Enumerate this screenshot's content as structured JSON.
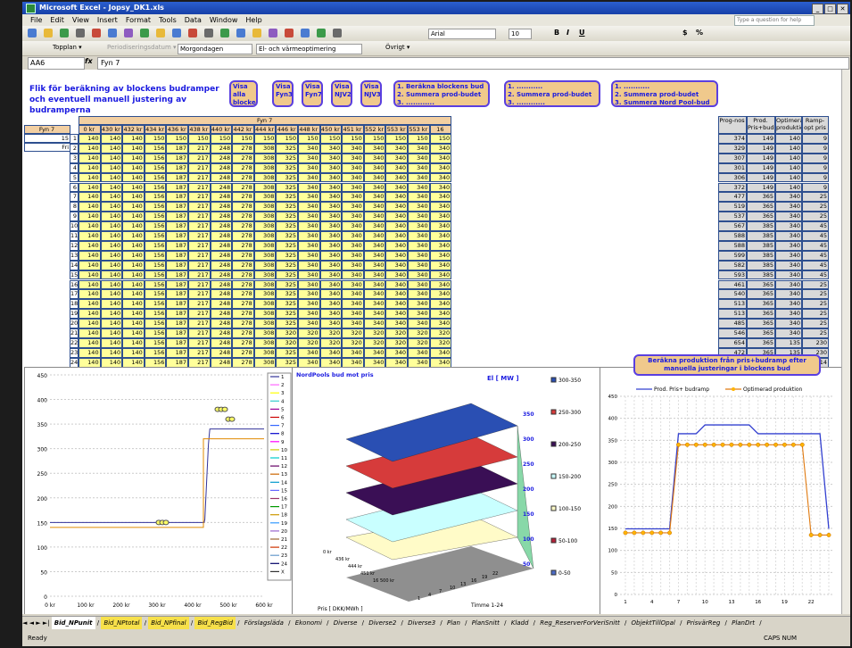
{
  "window": {
    "title": "Microsoft Excel - Jopsy_DK1.xls",
    "buttons": [
      "_",
      "□",
      "✕"
    ]
  },
  "menu": {
    "items": [
      "File",
      "Edit",
      "View",
      "Insert",
      "Format",
      "Tools",
      "Data",
      "Window",
      "Help"
    ],
    "help_placeholder": "Type a question for help"
  },
  "toolbar": {
    "font": "Arial",
    "size": "10",
    "bold": "B",
    "italic": "I",
    "underline": "U",
    "currency": "$",
    "percent": "%"
  },
  "toolbar2": {
    "topplan": "Topplan ▾",
    "period": "Periodiseringsdatum ▾",
    "dropdown1": "Morgondagen",
    "dropdown2": "El- och värmeoptimering",
    "ovrigt": "Övrigt ▾"
  },
  "namebox": "AA6",
  "fx": "fx",
  "formula": "Fyn 7",
  "sheet": {
    "title": "Flik för beräkning av blockens budramper och eventuell manuell justering av budramperna",
    "buttons": [
      "Visa alla blocken",
      "Visa Fyn3",
      "Visa Fyn7",
      "Visa NJV2",
      "Visa NJV3"
    ],
    "step_box1": [
      "1. Beräkna blockens bud",
      "2. Summera prod-budet",
      "3. ............"
    ],
    "step_box2": [
      "1. ...........",
      "2. Summera prod-budet",
      "3. ............"
    ],
    "step_box3": [
      "1. ...........",
      "2. Summera prod-budet",
      "3. Summera Nord Pool-bud"
    ],
    "fyn_header": "Fyn 7",
    "selector": [
      "Fyn 7",
      "15",
      "Fri"
    ],
    "col_headers": [
      "0 kr",
      "430 kr",
      "432 kr",
      "434 kr",
      "436 kr",
      "438 kr",
      "440 kr",
      "442 kr",
      "444 kr",
      "446 kr",
      "448 kr",
      "450 kr",
      "451 kr",
      "552 kr",
      "553 kr",
      "553 kr",
      "16 500 kr"
    ],
    "right_headers": [
      "Prog-nos",
      "Prod. Pris+budramp",
      "Optimerad produktion",
      "Ramp-opt pris"
    ],
    "rows": [
      {
        "n": "1",
        "v": [
          "140",
          "140",
          "140",
          "150",
          "150",
          "150",
          "150",
          "150",
          "150",
          "150",
          "150",
          "150",
          "150",
          "150",
          "150",
          "150",
          "150"
        ],
        "r": [
          "374",
          "149",
          "140",
          "9"
        ]
      },
      {
        "n": "2",
        "v": [
          "140",
          "140",
          "140",
          "156",
          "187",
          "217",
          "248",
          "278",
          "308",
          "325",
          "340",
          "340",
          "340",
          "340",
          "340",
          "340",
          "340"
        ],
        "r": [
          "329",
          "149",
          "140",
          "9"
        ]
      },
      {
        "n": "3",
        "v": [
          "140",
          "140",
          "140",
          "156",
          "187",
          "217",
          "248",
          "278",
          "308",
          "325",
          "340",
          "340",
          "340",
          "340",
          "340",
          "340",
          "340"
        ],
        "r": [
          "307",
          "149",
          "140",
          "9"
        ]
      },
      {
        "n": "4",
        "v": [
          "140",
          "140",
          "140",
          "156",
          "187",
          "217",
          "248",
          "278",
          "308",
          "325",
          "340",
          "340",
          "340",
          "340",
          "340",
          "340",
          "340"
        ],
        "r": [
          "301",
          "149",
          "140",
          "9"
        ]
      },
      {
        "n": "5",
        "v": [
          "140",
          "140",
          "140",
          "156",
          "187",
          "217",
          "248",
          "278",
          "308",
          "325",
          "340",
          "340",
          "340",
          "340",
          "340",
          "340",
          "340"
        ],
        "r": [
          "306",
          "149",
          "140",
          "9"
        ]
      },
      {
        "n": "6",
        "v": [
          "140",
          "140",
          "140",
          "156",
          "187",
          "217",
          "248",
          "278",
          "308",
          "325",
          "340",
          "340",
          "340",
          "340",
          "340",
          "340",
          "340"
        ],
        "r": [
          "372",
          "149",
          "140",
          "9"
        ]
      },
      {
        "n": "7",
        "v": [
          "140",
          "140",
          "140",
          "156",
          "187",
          "217",
          "248",
          "278",
          "308",
          "325",
          "340",
          "340",
          "340",
          "340",
          "340",
          "340",
          "340"
        ],
        "r": [
          "477",
          "365",
          "340",
          "25"
        ]
      },
      {
        "n": "8",
        "v": [
          "140",
          "140",
          "140",
          "156",
          "187",
          "217",
          "248",
          "278",
          "308",
          "325",
          "340",
          "340",
          "340",
          "340",
          "340",
          "340",
          "340"
        ],
        "r": [
          "519",
          "365",
          "340",
          "25"
        ]
      },
      {
        "n": "9",
        "v": [
          "140",
          "140",
          "140",
          "156",
          "187",
          "217",
          "248",
          "278",
          "308",
          "325",
          "340",
          "340",
          "340",
          "340",
          "340",
          "340",
          "340"
        ],
        "r": [
          "537",
          "365",
          "340",
          "25"
        ]
      },
      {
        "n": "10",
        "v": [
          "140",
          "140",
          "140",
          "156",
          "187",
          "217",
          "248",
          "278",
          "308",
          "325",
          "340",
          "340",
          "340",
          "340",
          "340",
          "340",
          "340"
        ],
        "r": [
          "567",
          "385",
          "340",
          "45"
        ]
      },
      {
        "n": "11",
        "v": [
          "140",
          "140",
          "140",
          "156",
          "187",
          "217",
          "248",
          "278",
          "308",
          "325",
          "340",
          "340",
          "340",
          "340",
          "340",
          "340",
          "340"
        ],
        "r": [
          "588",
          "385",
          "340",
          "45"
        ]
      },
      {
        "n": "12",
        "v": [
          "140",
          "140",
          "140",
          "156",
          "187",
          "217",
          "248",
          "278",
          "308",
          "325",
          "340",
          "340",
          "340",
          "340",
          "340",
          "340",
          "340"
        ],
        "r": [
          "588",
          "385",
          "340",
          "45"
        ]
      },
      {
        "n": "13",
        "v": [
          "140",
          "140",
          "140",
          "156",
          "187",
          "217",
          "248",
          "278",
          "308",
          "325",
          "340",
          "340",
          "340",
          "340",
          "340",
          "340",
          "340"
        ],
        "r": [
          "599",
          "385",
          "340",
          "45"
        ]
      },
      {
        "n": "14",
        "v": [
          "140",
          "140",
          "140",
          "156",
          "187",
          "217",
          "248",
          "278",
          "308",
          "325",
          "340",
          "340",
          "340",
          "340",
          "340",
          "340",
          "340"
        ],
        "r": [
          "582",
          "385",
          "340",
          "45"
        ]
      },
      {
        "n": "15",
        "v": [
          "140",
          "140",
          "140",
          "156",
          "187",
          "217",
          "248",
          "278",
          "308",
          "325",
          "340",
          "340",
          "340",
          "340",
          "340",
          "340",
          "340"
        ],
        "r": [
          "593",
          "385",
          "340",
          "45"
        ]
      },
      {
        "n": "16",
        "v": [
          "140",
          "140",
          "140",
          "156",
          "187",
          "217",
          "248",
          "278",
          "308",
          "325",
          "340",
          "340",
          "340",
          "340",
          "340",
          "340",
          "340"
        ],
        "r": [
          "461",
          "365",
          "340",
          "25"
        ]
      },
      {
        "n": "17",
        "v": [
          "140",
          "140",
          "140",
          "156",
          "187",
          "217",
          "248",
          "278",
          "308",
          "325",
          "340",
          "340",
          "340",
          "340",
          "340",
          "340",
          "340"
        ],
        "r": [
          "540",
          "365",
          "340",
          "25"
        ]
      },
      {
        "n": "18",
        "v": [
          "140",
          "140",
          "140",
          "156",
          "187",
          "217",
          "248",
          "278",
          "308",
          "325",
          "340",
          "340",
          "340",
          "340",
          "340",
          "340",
          "340"
        ],
        "r": [
          "513",
          "365",
          "340",
          "25"
        ]
      },
      {
        "n": "19",
        "v": [
          "140",
          "140",
          "140",
          "156",
          "187",
          "217",
          "248",
          "278",
          "308",
          "325",
          "340",
          "340",
          "340",
          "340",
          "340",
          "340",
          "340"
        ],
        "r": [
          "513",
          "365",
          "340",
          "25"
        ]
      },
      {
        "n": "20",
        "v": [
          "140",
          "140",
          "140",
          "156",
          "187",
          "217",
          "248",
          "278",
          "308",
          "325",
          "340",
          "340",
          "340",
          "340",
          "340",
          "340",
          "340"
        ],
        "r": [
          "485",
          "365",
          "340",
          "25"
        ]
      },
      {
        "n": "21",
        "v": [
          "140",
          "140",
          "140",
          "156",
          "187",
          "217",
          "248",
          "278",
          "308",
          "320",
          "320",
          "320",
          "320",
          "320",
          "320",
          "320",
          "320"
        ],
        "r": [
          "546",
          "365",
          "340",
          "25"
        ]
      },
      {
        "n": "22",
        "v": [
          "140",
          "140",
          "140",
          "156",
          "187",
          "217",
          "248",
          "278",
          "308",
          "320",
          "320",
          "320",
          "320",
          "320",
          "320",
          "320",
          "320"
        ],
        "r": [
          "654",
          "365",
          "135",
          "230"
        ]
      },
      {
        "n": "23",
        "v": [
          "140",
          "140",
          "140",
          "156",
          "187",
          "217",
          "248",
          "278",
          "308",
          "325",
          "340",
          "340",
          "340",
          "340",
          "340",
          "340",
          "340"
        ],
        "r": [
          "472",
          "365",
          "135",
          "230"
        ]
      },
      {
        "n": "24",
        "v": [
          "140",
          "140",
          "140",
          "156",
          "187",
          "217",
          "248",
          "278",
          "308",
          "325",
          "340",
          "340",
          "340",
          "340",
          "340",
          "340",
          "340"
        ],
        "r": [
          "373",
          "149",
          "135",
          "14"
        ]
      }
    ]
  },
  "chart_left": {
    "y_ticks": [
      "0",
      "50",
      "100",
      "150",
      "200",
      "250",
      "300",
      "350",
      "400",
      "450"
    ],
    "x_ticks": [
      "0 kr",
      "100 kr",
      "200 kr",
      "300 kr",
      "400 kr",
      "500 kr",
      "600 kr"
    ],
    "legend": [
      "1",
      "2",
      "3",
      "4",
      "5",
      "6",
      "7",
      "8",
      "9",
      "10",
      "11",
      "12",
      "13",
      "14",
      "15",
      "16",
      "17",
      "18",
      "19",
      "20",
      "21",
      "22",
      "23",
      "24",
      "X"
    ]
  },
  "chart_3d": {
    "title": "NordPools bud mot pris",
    "zlabel": "El [ MW ]",
    "z_ticks": [
      "50",
      "100",
      "150",
      "200",
      "250",
      "300",
      "350"
    ],
    "xlabel": "Pris [ DKK/MWh ]",
    "ylabel": "Timme 1-24",
    "x_ticks": [
      "0 kr",
      "436 kr",
      "444 kr",
      "451 kr",
      "16 500 kr"
    ],
    "y_ticks": [
      "1",
      "4",
      "7",
      "10",
      "13",
      "16",
      "19",
      "22"
    ],
    "legend": [
      {
        "label": "300-350",
        "color": "#2a4fb3"
      },
      {
        "label": "250-300",
        "color": "#d63b3b"
      },
      {
        "label": "200-250",
        "color": "#3a0f55"
      },
      {
        "label": "150-200",
        "color": "#c9ffff"
      },
      {
        "label": "100-150",
        "color": "#fffbc8"
      },
      {
        "label": "50-100",
        "color": "#b4223a"
      },
      {
        "label": "0-50",
        "color": "#4e6cc7"
      }
    ]
  },
  "chart_right": {
    "button": "Beräkna produktion från pris+budramp efter manuella justeringar i blockens bud",
    "legend": [
      "Prod. Pris+ budramp",
      "Optimerad produktion"
    ],
    "y_ticks": [
      "0",
      "50",
      "100",
      "150",
      "200",
      "250",
      "300",
      "350",
      "400",
      "450"
    ],
    "x_ticks": [
      "1",
      "4",
      "7",
      "10",
      "13",
      "16",
      "19",
      "22"
    ]
  },
  "chart_data": [
    {
      "type": "line",
      "title": "",
      "x": [
        "1",
        "2",
        "3",
        "4",
        "5",
        "6",
        "7",
        "8",
        "9",
        "10",
        "11",
        "12",
        "13",
        "14",
        "15",
        "16",
        "17",
        "18",
        "19",
        "20",
        "21",
        "22",
        "23",
        "24"
      ],
      "ylim": [
        0,
        450
      ],
      "series": [
        {
          "name": "Prod. Pris+ budramp",
          "values": [
            149,
            149,
            149,
            149,
            149,
            149,
            365,
            365,
            365,
            385,
            385,
            385,
            385,
            385,
            385,
            365,
            365,
            365,
            365,
            365,
            365,
            365,
            365,
            149
          ]
        },
        {
          "name": "Optimerad produktion",
          "values": [
            140,
            140,
            140,
            140,
            140,
            140,
            340,
            340,
            340,
            340,
            340,
            340,
            340,
            340,
            340,
            340,
            340,
            340,
            340,
            340,
            340,
            135,
            135,
            135
          ]
        }
      ]
    }
  ],
  "sheet_tabs": [
    "Bid_NPunit",
    "Bid_NPtotal",
    "Bid_NPfinal",
    "Bid_RegBid",
    "Förslagsläda",
    "Ekonomi",
    "Diverse",
    "Diverse2",
    "Diverse3",
    "Plan",
    "PlanSnitt",
    "Kladd",
    "Reg_ReserverForVeriSnitt",
    "ObjektTillOpal",
    "PrisvärReg",
    "PlanDrt"
  ],
  "status": {
    "left": "Ready",
    "right": "CAPS NUM"
  }
}
